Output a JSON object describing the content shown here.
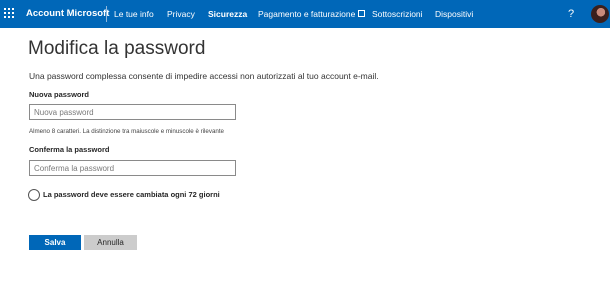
{
  "header": {
    "brand": "Account Microsoft",
    "nav": [
      {
        "label": "Le tue info"
      },
      {
        "label": "Privacy"
      },
      {
        "label": "Sicurezza"
      },
      {
        "label": "Pagamento e fatturazione"
      },
      {
        "label": "Sottoscrizioni"
      },
      {
        "label": "Dispositivi"
      }
    ],
    "help": "?",
    "icons": [
      "waffle-icon",
      "external-link-icon",
      "help-icon",
      "avatar"
    ],
    "accent": "#0067b8"
  },
  "main": {
    "title": "Modifica la password",
    "description": "Una password complessa consente di impedire accessi non autorizzati al tuo account e-mail.",
    "new_password": {
      "label": "Nuova password",
      "placeholder": "Nuova password",
      "value": "",
      "hint": "Almeno 8 caratteri. La distinzione tra maiuscole e minuscole è rilevante"
    },
    "confirm_password": {
      "label": "Conferma la password",
      "placeholder": "Conferma la password",
      "value": ""
    },
    "expire_checkbox": {
      "label": "La password deve essere cambiata ogni 72 giorni",
      "checked": false
    },
    "buttons": {
      "save": "Salva",
      "cancel": "Annulla"
    }
  }
}
